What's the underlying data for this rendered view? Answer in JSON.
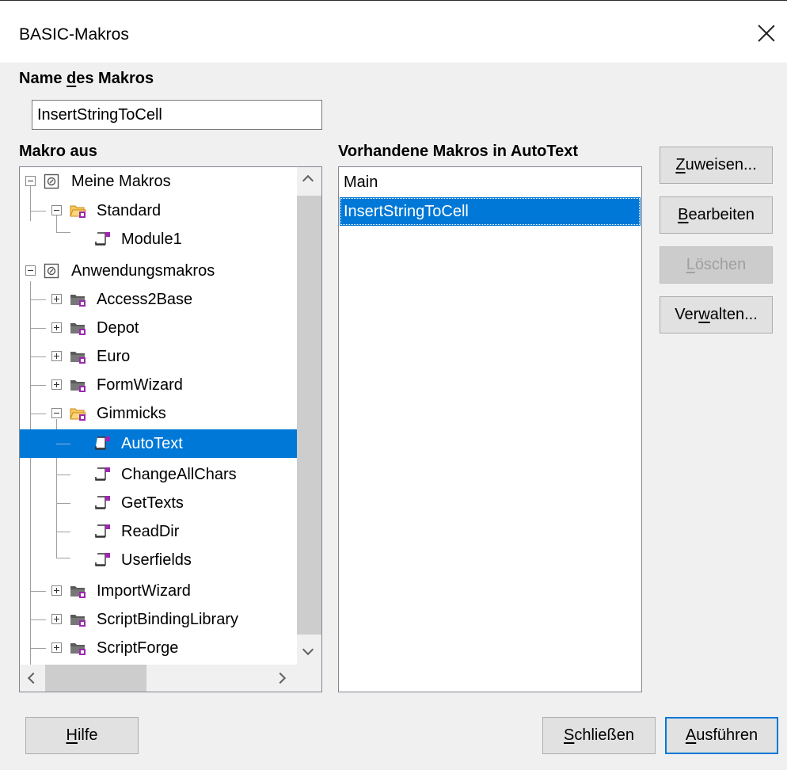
{
  "window": {
    "title": "BASIC-Makros"
  },
  "macro_name": {
    "label_pre": "Name ",
    "label_u": "d",
    "label_post": "es Makros",
    "value": "InsertStringToCell"
  },
  "tree": {
    "label": "Makro aus",
    "items": [
      {
        "label": "Meine Makros"
      },
      {
        "label": "Standard"
      },
      {
        "label": "Module1"
      },
      {
        "label": "Anwendungsmakros"
      },
      {
        "label": "Access2Base"
      },
      {
        "label": "Depot"
      },
      {
        "label": "Euro"
      },
      {
        "label": "FormWizard"
      },
      {
        "label": "Gimmicks"
      },
      {
        "label": "AutoText"
      },
      {
        "label": "ChangeAllChars"
      },
      {
        "label": "GetTexts"
      },
      {
        "label": "ReadDir"
      },
      {
        "label": "Userfields"
      },
      {
        "label": "ImportWizard"
      },
      {
        "label": "ScriptBindingLibrary"
      },
      {
        "label": "ScriptForge"
      }
    ],
    "selected": "AutoText"
  },
  "macros": {
    "label": "Vorhandene Makros in AutoText",
    "items": [
      "Main",
      "InsertStringToCell"
    ],
    "selected": "InsertStringToCell"
  },
  "buttons": {
    "assign": {
      "u": "Z",
      "rest": "uweisen..."
    },
    "edit": {
      "u": "B",
      "rest": "earbeiten"
    },
    "delete": {
      "u": "L",
      "rest": "öschen",
      "enabled": false
    },
    "manage": {
      "pre": "Ver",
      "u": "w",
      "rest": "alten..."
    },
    "help": {
      "u": "H",
      "rest": "ilfe"
    },
    "close": {
      "u": "S",
      "rest": "chließen"
    },
    "run": {
      "u": "A",
      "rest": "usführen"
    }
  },
  "colors": {
    "selection": "#0078d7",
    "library_folder_open": "#f0b43c",
    "module_icon": "#9c27b0"
  }
}
